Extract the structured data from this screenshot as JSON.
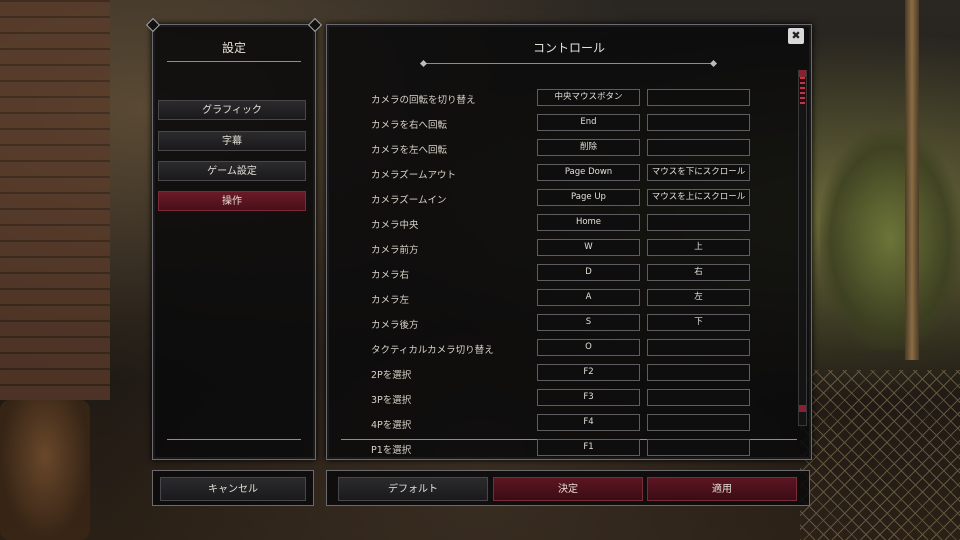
{
  "sidebar": {
    "title": "設定",
    "items": [
      {
        "label": "グラフィック"
      },
      {
        "label": "字幕"
      },
      {
        "label": "ゲーム設定"
      },
      {
        "label": "操作"
      }
    ],
    "active_index": 3,
    "cancel_label": "キャンセル"
  },
  "main": {
    "title": "コントロール",
    "rows": [
      {
        "action": "カメラの回転を切り替え",
        "key1": "中央マウスボタン",
        "key2": ""
      },
      {
        "action": "カメラを右へ回転",
        "key1": "End",
        "key2": ""
      },
      {
        "action": "カメラを左へ回転",
        "key1": "削除",
        "key2": ""
      },
      {
        "action": "カメラズームアウト",
        "key1": "Page Down",
        "key2": "マウスを下にスクロール"
      },
      {
        "action": "カメラズームイン",
        "key1": "Page Up",
        "key2": "マウスを上にスクロール"
      },
      {
        "action": "カメラ中央",
        "key1": "Home",
        "key2": ""
      },
      {
        "action": "カメラ前方",
        "key1": "W",
        "key2": "上"
      },
      {
        "action": "カメラ右",
        "key1": "D",
        "key2": "右"
      },
      {
        "action": "カメラ左",
        "key1": "A",
        "key2": "左"
      },
      {
        "action": "カメラ後方",
        "key1": "S",
        "key2": "下"
      },
      {
        "action": "タクティカルカメラ切り替え",
        "key1": "O",
        "key2": ""
      },
      {
        "action": "2Pを選択",
        "key1": "F2",
        "key2": ""
      },
      {
        "action": "3Pを選択",
        "key1": "F3",
        "key2": ""
      },
      {
        "action": "4Pを選択",
        "key1": "F4",
        "key2": ""
      },
      {
        "action": "P1を選択",
        "key1": "F1",
        "key2": ""
      }
    ]
  },
  "footer": {
    "default_label": "デフォルト",
    "confirm_label": "決定",
    "apply_label": "適用"
  },
  "close_icon_glyph": "✖",
  "colors": {
    "accent_red": "#6a1a28",
    "panel_bg": "#0a0a0b",
    "border": "#6b6a6e"
  }
}
